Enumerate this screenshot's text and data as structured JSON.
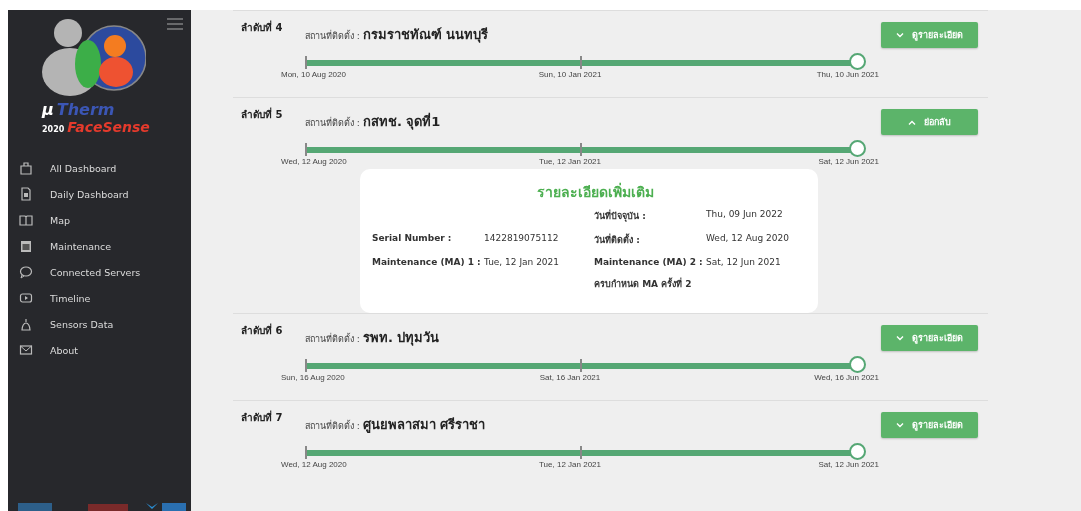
{
  "sidebar": {
    "logo": {
      "mu": "μ",
      "name": "Therm",
      "year": "2020",
      "brand": "FaceSense"
    },
    "items": [
      {
        "label": "All Dashboard"
      },
      {
        "label": "Daily Dashboard"
      },
      {
        "label": "Map"
      },
      {
        "label": "Maintenance"
      },
      {
        "label": "Connected Servers"
      },
      {
        "label": "Timeline"
      },
      {
        "label": "Sensors Data"
      },
      {
        "label": "About"
      }
    ]
  },
  "timeline": [
    {
      "order": "ลำดับที่ 4",
      "place_label": "สถานที่ติดตั้ง :",
      "place": "กรมราชทัณฑ์ นนทบุรี",
      "dates": [
        "Mon, 10 Aug 2020",
        "Sun, 10 Jan 2021",
        "Thu, 10 Jun 2021"
      ],
      "button": "ดูรายละเอียด",
      "expanded": false
    },
    {
      "order": "ลำดับที่ 5",
      "place_label": "สถานที่ติดตั้ง :",
      "place": "กสทช. จุดที่1",
      "dates": [
        "Wed, 12 Aug 2020",
        "Tue, 12 Jan 2021",
        "Sat, 12 Jun 2021"
      ],
      "button": "ย่อกลับ",
      "expanded": true,
      "details": {
        "title": "รายละเอียดเพิ่มเติม",
        "fields": [
          {
            "label": "วันที่ปัจจุบัน :",
            "value": "Thu, 09 Jun 2022"
          },
          {
            "label": "Serial Number :",
            "value": "1422819075112"
          },
          {
            "label": "วันที่ติดตั้ง :",
            "value": "Wed, 12 Aug 2020"
          },
          {
            "label": "Maintenance (MA) 1 :",
            "value": "Tue, 12 Jan 2021"
          },
          {
            "label": "Maintenance (MA) 2 :",
            "value": "Sat, 12 Jun 2021"
          }
        ],
        "note": "ครบกำหนด MA ครั้งที่ 2"
      }
    },
    {
      "order": "ลำดับที่ 6",
      "place_label": "สถานที่ติดตั้ง :",
      "place": "รพท. ปทุมวัน",
      "dates": [
        "Sun, 16 Aug 2020",
        "Sat, 16 Jan 2021",
        "Wed, 16 Jun 2021"
      ],
      "button": "ดูรายละเอียด",
      "expanded": false
    },
    {
      "order": "ลำดับที่ 7",
      "place_label": "สถานที่ติดตั้ง :",
      "place": "ศูนยพลาสมา ศรีราชา",
      "dates": [
        "Wed, 12 Aug 2020",
        "Tue, 12 Jan 2021",
        "Sat, 12 Jun 2021"
      ],
      "button": "ดูรายละเอียด",
      "expanded": false
    }
  ]
}
